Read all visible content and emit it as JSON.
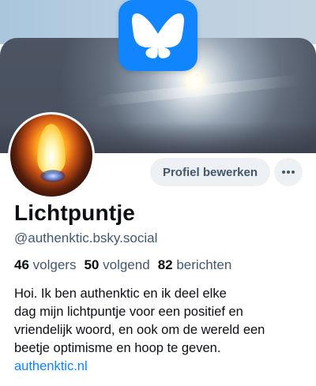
{
  "profile": {
    "display_name": "Lichtpuntje",
    "handle": "@authenktic.bsky.social",
    "edit_button_label": "Profiel bewerken",
    "more_button_label": "···",
    "stats": {
      "followers_count": "46",
      "followers_label": "volgers",
      "following_count": "50",
      "following_label": "volgend",
      "posts_count": "82",
      "posts_label": "berichten"
    },
    "bio_lines": [
      "Hoi. Ik ben authenktic en ik deel elke",
      "dag mijn lichtpuntje voor een positief en",
      "vriendelijk woord, en ook om de wereld een",
      "beetje optimisme en hoop te geven."
    ],
    "bio_link": "authenktic.nl"
  },
  "icons": {
    "app_logo": "butterfly-icon",
    "more": "ellipsis-icon"
  },
  "colors": {
    "brand_blue": "#1185fe",
    "link": "#1083fe",
    "muted_text": "#42576c",
    "button_bg": "#eef1f4"
  }
}
